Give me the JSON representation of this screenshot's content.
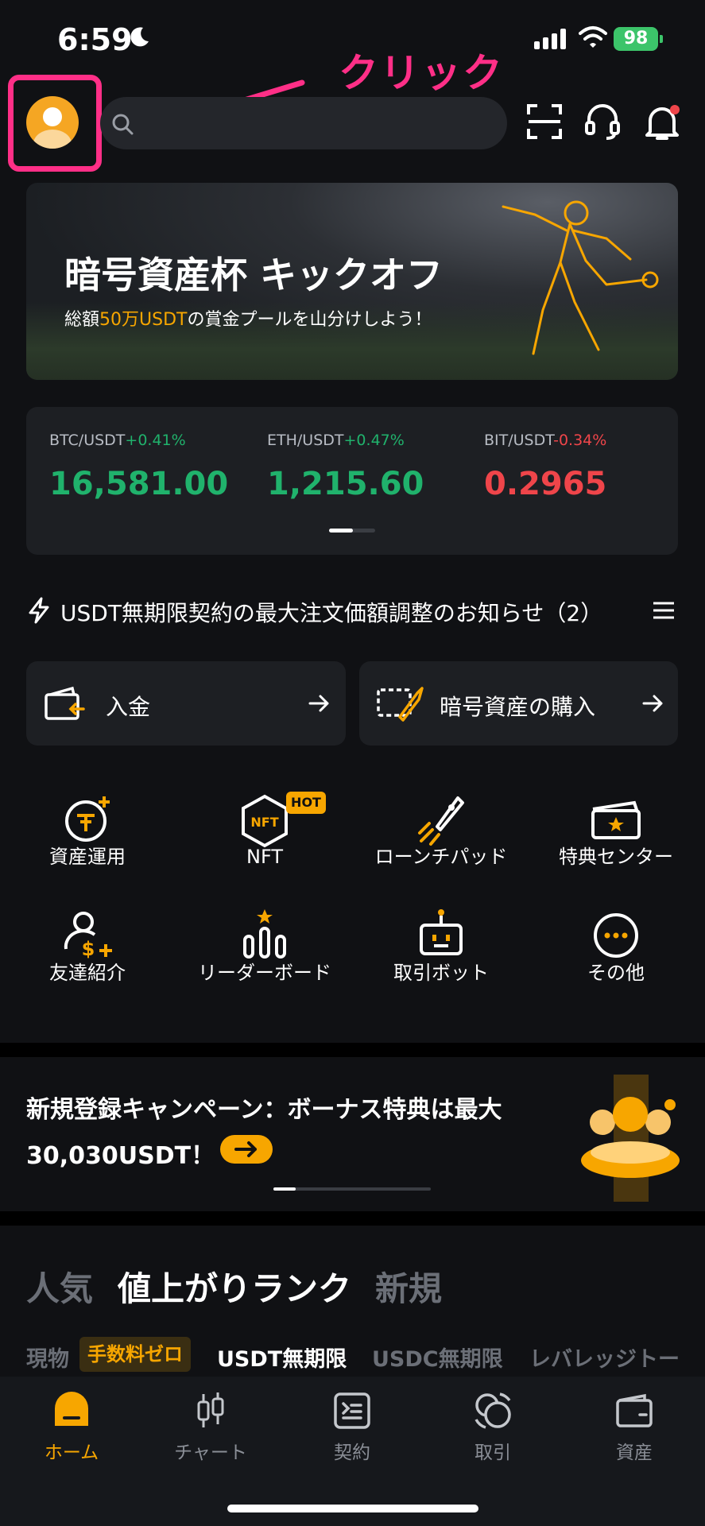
{
  "status_bar": {
    "time": "6:59",
    "battery": "98"
  },
  "annotation": {
    "text": "クリック"
  },
  "header": {
    "search_placeholder": ""
  },
  "banner": {
    "title": "暗号資産杯 キックオフ",
    "subtitle_prefix": "総額",
    "subtitle_highlight": "50万USDT",
    "subtitle_suffix": "の賞金プールを山分けしよう！"
  },
  "ticker": [
    {
      "pair": "BTC/USDT",
      "change": "+0.41%",
      "price": "16,581.00",
      "direction": "up"
    },
    {
      "pair": "ETH/USDT",
      "change": "+0.47%",
      "price": "1,215.60",
      "direction": "up"
    },
    {
      "pair": "BIT/USDT",
      "change": "-0.34%",
      "price": "0.2965",
      "direction": "down"
    }
  ],
  "notice": {
    "text": "USDT無期限契約の最大注文価額調整のお知らせ（2）"
  },
  "actions": {
    "deposit": "入金",
    "buy_crypto": "暗号資産の購入"
  },
  "features": [
    {
      "label": "資産運用",
      "icon": "earn-icon"
    },
    {
      "label": "NFT",
      "icon": "nft-icon",
      "badge": "HOT"
    },
    {
      "label": "ローンチパッド",
      "icon": "launchpad-icon"
    },
    {
      "label": "特典センター",
      "icon": "rewards-icon"
    },
    {
      "label": "友達紹介",
      "icon": "referral-icon"
    },
    {
      "label": "リーダーボード",
      "icon": "leaderboard-icon"
    },
    {
      "label": "取引ボット",
      "icon": "bot-icon"
    },
    {
      "label": "その他",
      "icon": "more-icon"
    }
  ],
  "campaign": {
    "line1": "新規登録キャンペーン：ボーナス特典は最大",
    "line2": "30,030USDT！"
  },
  "market_tabs": {
    "main": [
      "人気",
      "値上がりランク",
      "新規"
    ],
    "active_main": "値上がりランク",
    "sub": [
      "現物",
      "手数料ゼロ",
      "USDT無期限",
      "USDC無期限",
      "レバレッジトー"
    ],
    "active_sub": "USDT無期限"
  },
  "bottom_nav": [
    {
      "label": "ホーム",
      "icon": "home-icon",
      "active": true
    },
    {
      "label": "チャート",
      "icon": "chart-icon",
      "active": false
    },
    {
      "label": "契約",
      "icon": "contract-icon",
      "active": false
    },
    {
      "label": "取引",
      "icon": "trade-icon",
      "active": false
    },
    {
      "label": "資産",
      "icon": "wallet-icon",
      "active": false
    }
  ],
  "colors": {
    "accent": "#f7a600",
    "up": "#20b26c",
    "down": "#ef454a",
    "annotation": "#ff2f87"
  }
}
